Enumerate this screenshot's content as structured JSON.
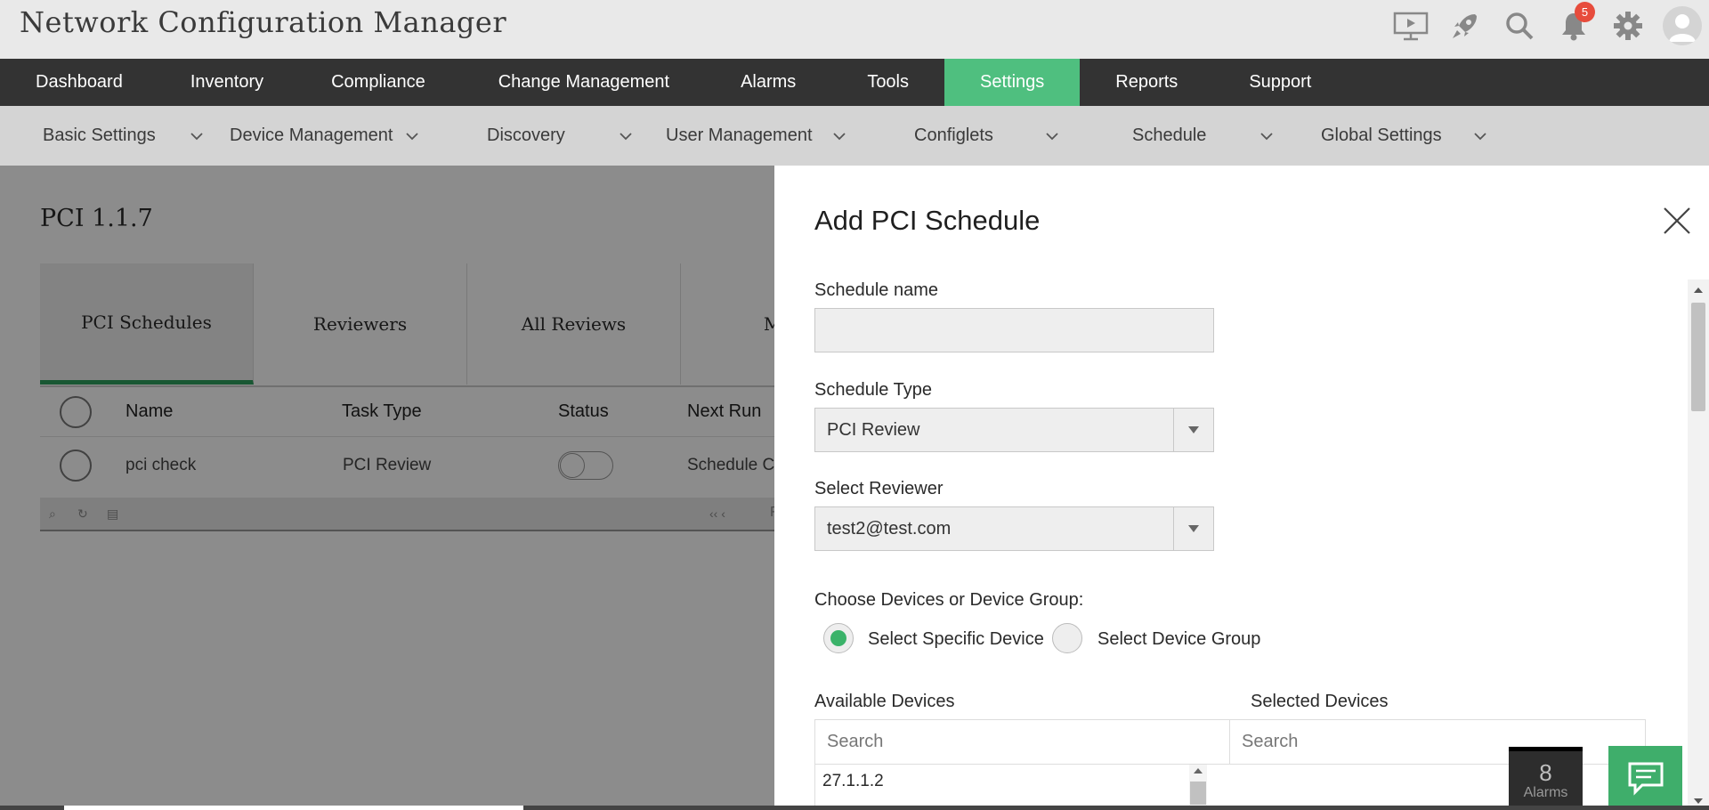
{
  "header": {
    "app_title": "Network Configuration Manager",
    "notification_count": "5"
  },
  "nav": {
    "items": [
      "Dashboard",
      "Inventory",
      "Compliance",
      "Change Management",
      "Alarms",
      "Tools",
      "Settings",
      "Reports",
      "Support"
    ],
    "active": "Settings"
  },
  "subnav": {
    "items": [
      "Basic Settings",
      "Device Management",
      "Discovery",
      "User Management",
      "Configlets",
      "Schedule",
      "Global Settings"
    ]
  },
  "page": {
    "title": "PCI 1.1.7",
    "tabs": [
      "PCI Schedules",
      "Reviewers",
      "All Reviews",
      "My R"
    ],
    "columns": [
      "Name",
      "Task Type",
      "Status",
      "Next Run"
    ],
    "rows": [
      {
        "name": "pci check",
        "task_type": "PCI Review",
        "next_run": "Schedule Co"
      }
    ],
    "footer_partial": "F"
  },
  "panel": {
    "title": "Add PCI Schedule",
    "schedule_name_label": "Schedule name",
    "schedule_name_value": "",
    "schedule_type_label": "Schedule Type",
    "schedule_type_value": "PCI Review",
    "reviewer_label": "Select Reviewer",
    "reviewer_value": "test2@test.com",
    "choose_label": "Choose Devices or Device Group:",
    "radio_specific": "Select Specific Device",
    "radio_group": "Select Device Group",
    "available_label": "Available Devices",
    "selected_label": "Selected Devices",
    "search_placeholder": "Search",
    "available_devices": [
      "27.1.1.2"
    ]
  },
  "floating": {
    "alarms_count": "8",
    "alarms_label": "Alarms"
  },
  "colors": {
    "accent_green": "#4fbf7f",
    "nav_bg": "#333333",
    "badge_red": "#e74c3c"
  }
}
